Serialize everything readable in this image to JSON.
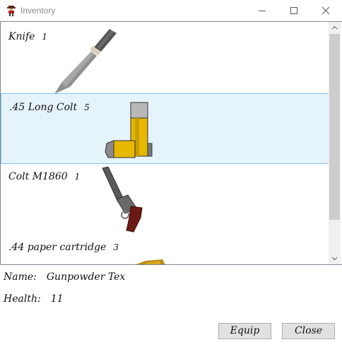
{
  "window": {
    "title": "Inventory",
    "app_icon": "gunslinger-icon"
  },
  "items": [
    {
      "name": "Knife",
      "count": "1",
      "icon": "knife-icon"
    },
    {
      "name": ".45 Long Colt",
      "count": "5",
      "icon": "cartridges-icon"
    },
    {
      "name": "Colt M1860",
      "count": "1",
      "icon": "revolver-icon"
    },
    {
      "name": ".44 paper cartridge",
      "count": "3",
      "icon": "paper-cartridge-icon"
    }
  ],
  "selected_item": ".45 Long Colt",
  "character": {
    "name_label": "Name:",
    "name_value": "Gunpowder Tex",
    "health_label": "Health:",
    "health_value": "11"
  },
  "buttons": {
    "equip": "Equip",
    "close": "Close"
  },
  "colors": {
    "selection_bg": "#e5f3fb",
    "selection_border": "#7fc6ef"
  }
}
